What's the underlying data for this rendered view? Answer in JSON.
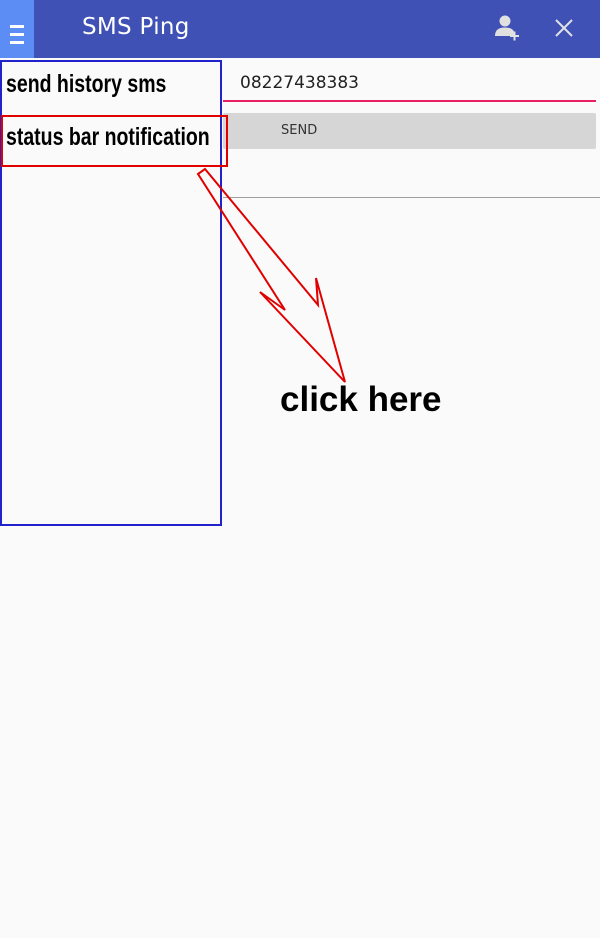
{
  "app": {
    "title": "SMS Ping"
  },
  "header": {
    "menu_icon": "hamburger-menu-icon",
    "add_contact_icon": "add-person-icon",
    "close_icon": "close-icon"
  },
  "form": {
    "phone_value": "08227438383",
    "send_label": "SEND"
  },
  "drawer": {
    "items": [
      {
        "label": "send history sms"
      },
      {
        "label": "status bar notification"
      }
    ]
  },
  "annotation": {
    "callout": "click here"
  },
  "colors": {
    "appbar": "#3f51b5",
    "menu_button": "#5c8df5",
    "input_underline": "#e91e63",
    "send_button": "#d6d6d6",
    "drawer_border": "#2222cc",
    "annotation_red": "#e10000"
  }
}
